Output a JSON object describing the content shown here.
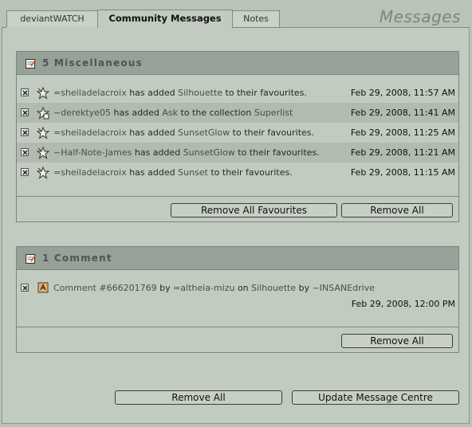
{
  "tabs": [
    "deviantWATCH",
    "Community Messages",
    "Notes"
  ],
  "page_title": "Messages",
  "misc": {
    "title": "5 Miscellaneous",
    "rows": [
      {
        "user": "=sheiladelacroix",
        "pre": " has added ",
        "item": "Silhouette",
        "post": " to their favourites.",
        "date": "Feb 29, 2008, 11:57 AM"
      },
      {
        "user": "~derektye05",
        "pre": " has added ",
        "item": "Ask",
        "post": " to the collection ",
        "extra": "Superlist",
        "date": "Feb 29, 2008, 11:41 AM"
      },
      {
        "user": "=sheiladelacroix",
        "pre": " has added ",
        "item": "SunsetGlow",
        "post": " to their favourites.",
        "date": "Feb 29, 2008, 11:25 AM"
      },
      {
        "user": "~Half-Note-James",
        "pre": " has added ",
        "item": "SunsetGlow",
        "post": " to their favourites.",
        "date": "Feb 29, 2008, 11:21 AM"
      },
      {
        "user": "=sheiladelacroix",
        "pre": " has added ",
        "item": "Sunset",
        "post": " to their favourites.",
        "date": "Feb 29, 2008, 11:15 AM"
      }
    ],
    "remove_favourites": "Remove All Favourites",
    "remove_all": "Remove All"
  },
  "comments": {
    "title": "1 Comment",
    "comment_link": "Comment #666201769",
    "by1": " by ",
    "author": "=altheia-mizu",
    "on": " on ",
    "deviation": "Silhouette",
    "by2": " by ",
    "artist": "~INSANEdrive",
    "date": "Feb 29, 2008, 12:00 PM",
    "remove_all": "Remove All"
  },
  "footer": {
    "remove_all": "Remove All",
    "update": "Update Message Centre"
  }
}
